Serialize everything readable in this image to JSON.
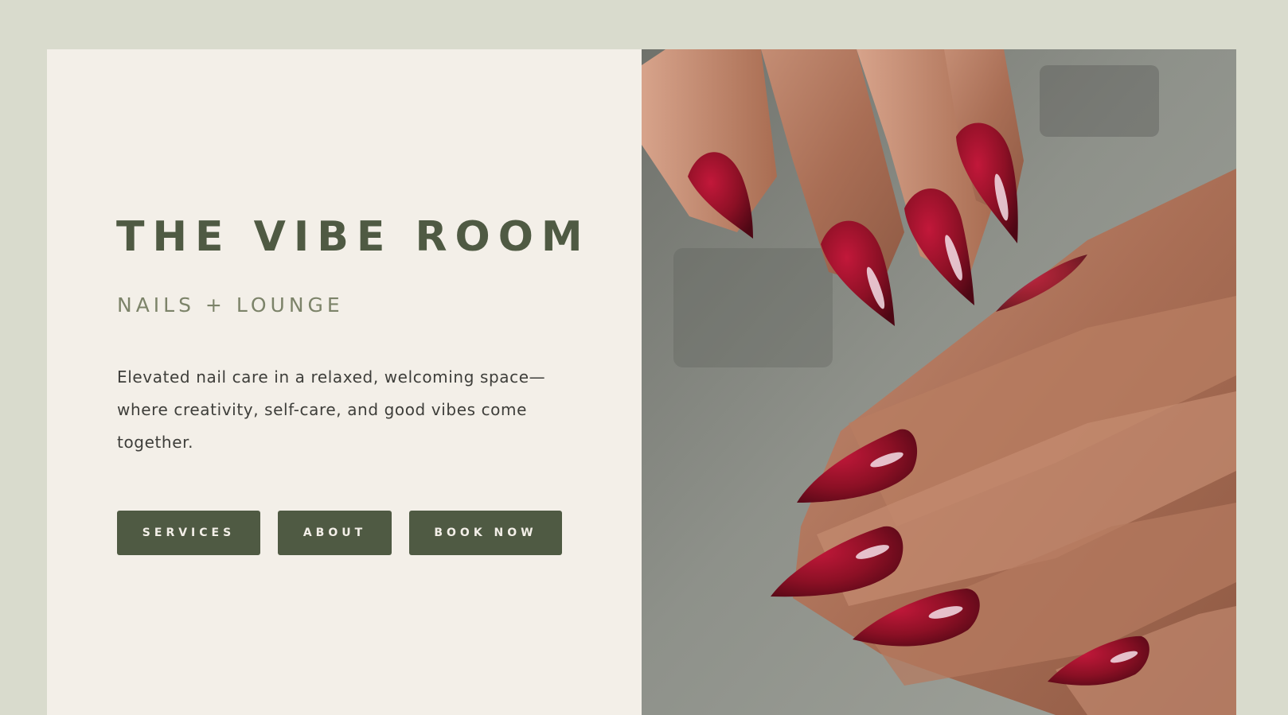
{
  "hero": {
    "title": "THE VIBE ROOM",
    "subtitle": "NAILS + LOUNGE",
    "description": "Elevated nail care in a relaxed, welcoming space—where creativity, self-care, and good vibes come together."
  },
  "buttons": {
    "services": "SERVICES",
    "about": "ABOUT",
    "book_now": "BOOK NOW"
  },
  "colors": {
    "page_background": "#d9dbcd",
    "panel_background": "#f3efe8",
    "accent_green": "#4f5a43",
    "subtitle_green": "#7c8369",
    "nail_polish": "#8c1025"
  },
  "image": {
    "subject": "manicured-hands-photo"
  }
}
